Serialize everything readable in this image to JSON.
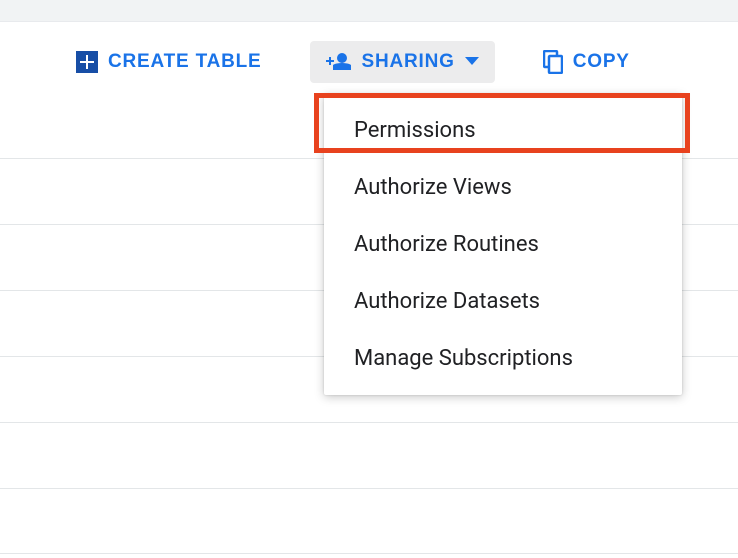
{
  "toolbar": {
    "create_table_label": "Create Table",
    "sharing_label": "Sharing",
    "copy_label": "Copy"
  },
  "sharing_menu": {
    "items": [
      {
        "label": "Permissions"
      },
      {
        "label": "Authorize Views"
      },
      {
        "label": "Authorize Routines"
      },
      {
        "label": "Authorize Datasets"
      },
      {
        "label": "Manage Subscriptions"
      }
    ]
  },
  "colors": {
    "accent": "#1a73e8",
    "highlight": "#e8421e"
  }
}
